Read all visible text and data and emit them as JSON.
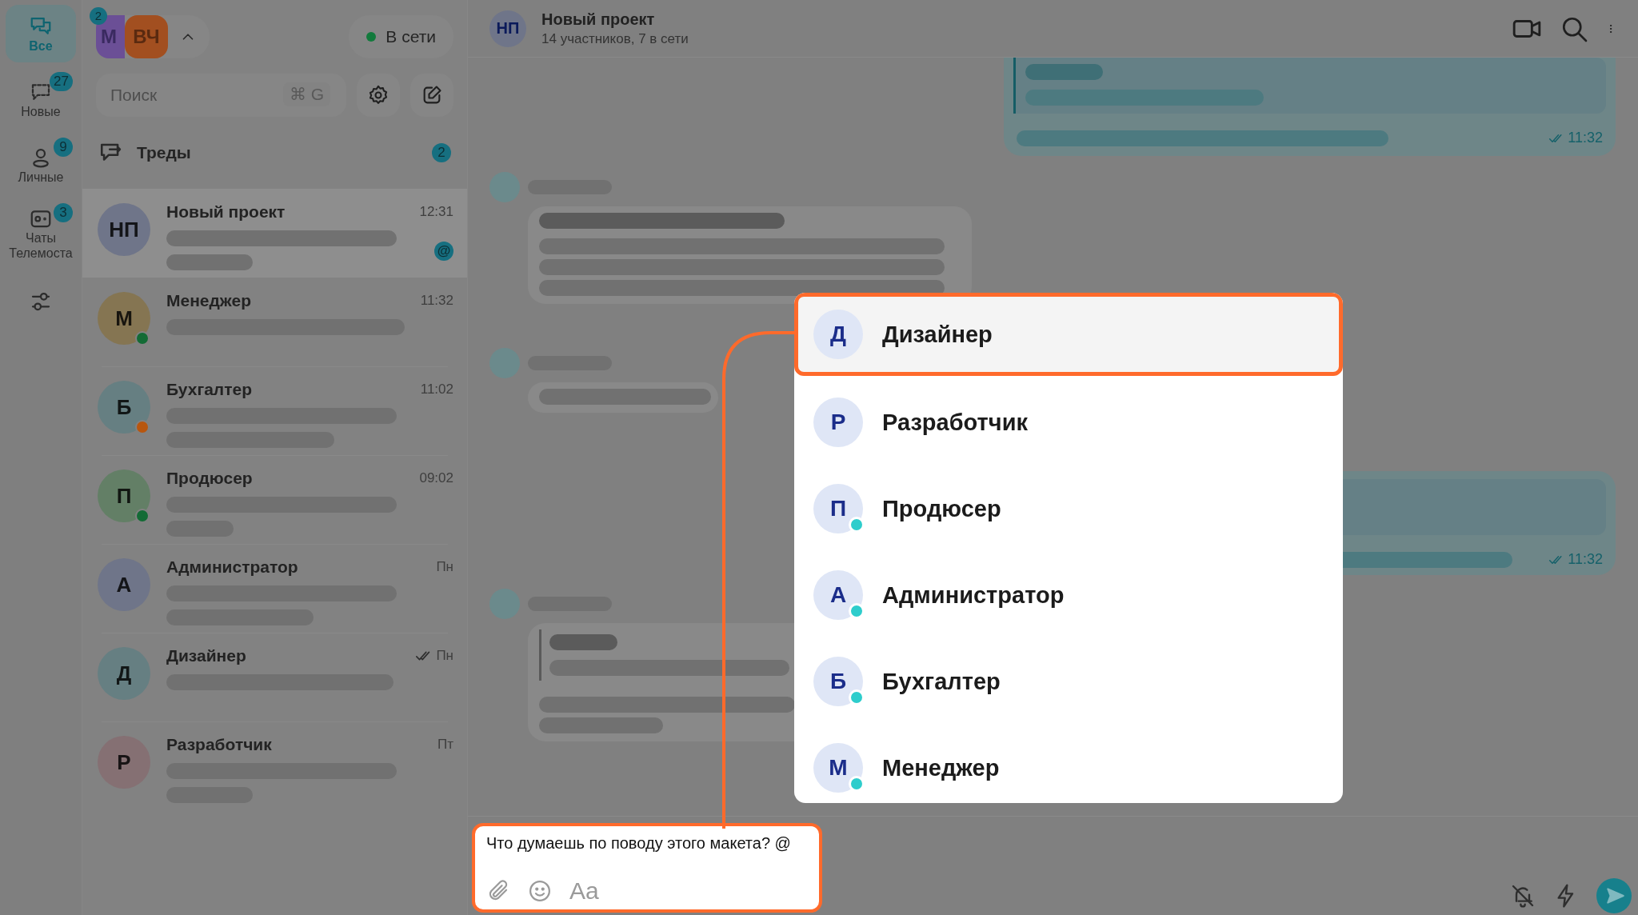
{
  "rail": {
    "items": [
      {
        "kind": "chats",
        "label": "Все",
        "selected": true
      },
      {
        "kind": "new",
        "label": "Новые",
        "badge": "27",
        "selected": false
      },
      {
        "kind": "personal",
        "label": "Личные",
        "badge": "9",
        "selected": false
      },
      {
        "kind": "meet",
        "label": "Чаты Телемоста",
        "badge": "3",
        "selected": false
      },
      {
        "kind": "filters",
        "selected": false
      }
    ]
  },
  "account": {
    "avatars": [
      {
        "initials": "М",
        "color": "#6b4f96"
      },
      {
        "initials": "ВЧ",
        "color": "#a24f20"
      }
    ],
    "badge": "2",
    "status": "В сети"
  },
  "search": {
    "placeholder": "Поиск",
    "shortcut": "⌘ G"
  },
  "threads": {
    "label": "Треды",
    "badge": "2"
  },
  "chats": [
    {
      "name": "Новый проект",
      "initials": "НП",
      "color": "#6f7589",
      "time": "12:31",
      "read": false,
      "mention": "@",
      "selected": true
    },
    {
      "name": "Менеджер",
      "initials": "М",
      "color": "#857552",
      "status_dot": {
        "color": "#136b35"
      },
      "time": "11:32",
      "read": false,
      "selected": false
    },
    {
      "name": "Бухгалтер",
      "initials": "Б",
      "color": "#667f82",
      "status_dot": {
        "color": "#b8560e"
      },
      "time": "11:02",
      "read": false,
      "selected": false
    },
    {
      "name": "Продюсер",
      "initials": "П",
      "color": "#637f66",
      "status_dot": {
        "color": "#136b35"
      },
      "time": "09:02",
      "read": false,
      "selected": false
    },
    {
      "name": "Администратор",
      "initials": "А",
      "color": "#6f7589",
      "time": "Пн",
      "read": false,
      "selected": false
    },
    {
      "name": "Дизайнер",
      "initials": "Д",
      "color": "#667f82",
      "time": "Пн",
      "read": true,
      "selected": false
    },
    {
      "name": "Разработчик",
      "initials": "Р",
      "color": "#857073",
      "time": "Пт",
      "read": false,
      "selected": false
    }
  ],
  "chat": {
    "initials": "НП",
    "title": "Новый проект",
    "subtitle": "14 участников, 7 в сети"
  },
  "messages": [
    {
      "kind": "outgoing",
      "time": "11:32",
      "read": true
    },
    {
      "kind": "incoming"
    },
    {
      "kind": "incoming"
    },
    {
      "kind": "outgoing",
      "time": "11:32",
      "read": true
    },
    {
      "kind": "incoming"
    }
  ],
  "mentions": [
    {
      "initials": "Д",
      "name": "Дизайнер",
      "online": false,
      "selected": true
    },
    {
      "initials": "Р",
      "name": "Разработчик",
      "online": false,
      "selected": false
    },
    {
      "initials": "П",
      "name": "Продюсер",
      "online": true,
      "selected": false
    },
    {
      "initials": "А",
      "name": "Администратор",
      "online": true,
      "selected": false
    },
    {
      "initials": "Б",
      "name": "Бухгалтер",
      "online": true,
      "selected": false
    },
    {
      "initials": "М",
      "name": "Менеджер",
      "online": true,
      "selected": false
    }
  ],
  "composer": {
    "value": "Что думаешь по поводу этого макета? @",
    "format": "Aa"
  }
}
